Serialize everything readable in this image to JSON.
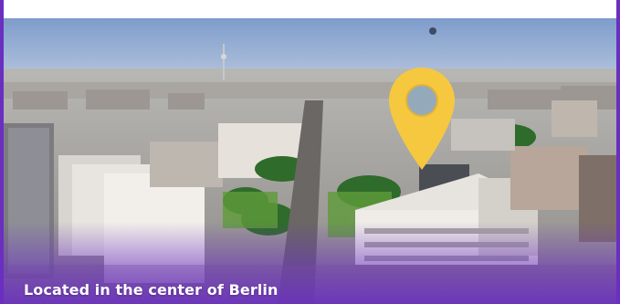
{
  "caption": {
    "text": "Located in the center of Berlin"
  },
  "map_pin": {
    "icon": "location-pin-icon",
    "color": "#f6c83f"
  },
  "colors": {
    "frame_purple": "#6a2fc0",
    "top_band": "#ffffff",
    "sky": "#8aa6c9"
  }
}
